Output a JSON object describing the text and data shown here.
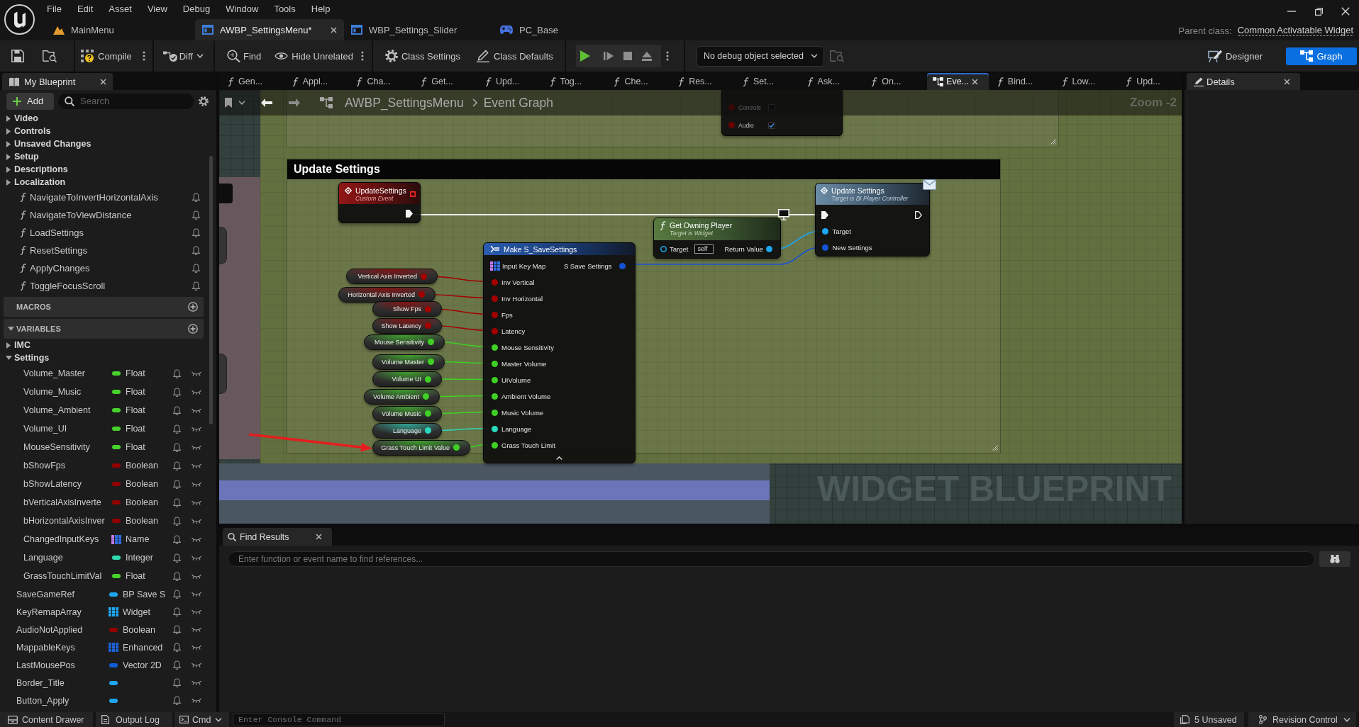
{
  "menu_bar": [
    "File",
    "Edit",
    "Asset",
    "View",
    "Debug",
    "Window",
    "Tools",
    "Help"
  ],
  "asset_tabs": [
    {
      "label": "MainMenu",
      "kind": "level",
      "selected": false
    },
    {
      "label": "AWBP_SettingsMenu*",
      "kind": "widget",
      "selected": true
    },
    {
      "label": "WBP_Settings_Slider",
      "kind": "widget",
      "selected": false
    },
    {
      "label": "PC_Base",
      "kind": "controller",
      "selected": false
    }
  ],
  "parent_class": {
    "label": "Parent class:",
    "value": "Common Activatable Widget"
  },
  "toolbar": {
    "buttons": [
      {
        "kind": "compile",
        "label": "Compile"
      },
      {
        "kind": "diff",
        "label": "Diff"
      },
      {
        "kind": "find",
        "label": "Find"
      },
      {
        "kind": "hide",
        "label": "Hide Unrelated"
      },
      {
        "kind": "settings",
        "label": "Class Settings"
      },
      {
        "kind": "defaults",
        "label": "Class Defaults"
      }
    ],
    "debug_object": "No debug object selected",
    "modes": [
      {
        "kind": "designer",
        "label": "Designer",
        "selected": false
      },
      {
        "kind": "graph",
        "label": "Graph",
        "selected": true
      }
    ]
  },
  "my_blueprint": {
    "tab": "My Blueprint",
    "add": "Add",
    "search": {
      "placeholder": "Search"
    },
    "categories": [
      {
        "label": "Video",
        "expanded": false
      },
      {
        "label": "Controls",
        "expanded": false
      },
      {
        "label": "Unsaved Changes",
        "expanded": false
      },
      {
        "label": "Setup",
        "expanded": false
      },
      {
        "label": "Descriptions",
        "expanded": false
      },
      {
        "label": "Localization",
        "expanded": false
      }
    ],
    "functions": [
      "NavigateToInvertHorizontalAxis",
      "NavigateToViewDistance",
      "LoadSettings",
      "ResetSettings",
      "ApplyChanges",
      "ToggleFocusScroll"
    ],
    "macros": {
      "label": "MACROS"
    },
    "variables": {
      "label": "VARIABLES",
      "expanded": true,
      "items": [
        {
          "kind": "category",
          "label": "IMC",
          "expanded": false
        },
        {
          "kind": "category",
          "label": "Settings",
          "expanded": true,
          "children": [
            {
              "name": "Volume_Master",
              "type": "Float",
              "kind": "single",
              "color": "#48d22c"
            },
            {
              "name": "Volume_Music",
              "type": "Float",
              "kind": "single",
              "color": "#48d22c"
            },
            {
              "name": "Volume_Ambient",
              "type": "Float",
              "kind": "single",
              "color": "#48d22c"
            },
            {
              "name": "Volume_UI",
              "type": "Float",
              "kind": "single",
              "color": "#48d22c"
            },
            {
              "name": "MouseSensitivity",
              "type": "Float",
              "kind": "single",
              "color": "#48d22c"
            },
            {
              "name": "bShowFps",
              "type": "Boolean",
              "kind": "single",
              "color": "#940000"
            },
            {
              "name": "bShowLatency",
              "type": "Boolean",
              "kind": "single",
              "color": "#940000"
            },
            {
              "name": "bVerticalAxisInverte",
              "type": "Boolean",
              "kind": "single",
              "color": "#940000"
            },
            {
              "name": "bHorizontalAxisInver",
              "type": "Boolean",
              "kind": "single",
              "color": "#940000"
            },
            {
              "name": "ChangedInputKeys",
              "type": "Name",
              "kind": "map",
              "color": "#c67cf0"
            },
            {
              "name": "Language",
              "type": "Integer",
              "kind": "single",
              "color": "#2ddcb2"
            },
            {
              "name": "GrassTouchLimitVal",
              "type": "Float",
              "kind": "single",
              "color": "#48d22c"
            }
          ]
        },
        {
          "kind": "single",
          "name": "SaveGameRef",
          "type": "BP Save S",
          "color": "#1ea6ee"
        },
        {
          "kind": "array",
          "name": "KeyRemapArray",
          "type": "Widget",
          "color": "#1ea6ee"
        },
        {
          "kind": "single",
          "name": "AudioNotApplied",
          "type": "Boolean",
          "color": "#940000"
        },
        {
          "kind": "array",
          "name": "MappableKeys",
          "type": "Enhanced",
          "color": "#1c62d8"
        },
        {
          "kind": "single",
          "name": "LastMousePos",
          "type": "Vector 2D",
          "color": "#0f5ed8"
        },
        {
          "kind": "single",
          "name": "Border_Title",
          "color": "#1ea6ee"
        },
        {
          "kind": "single",
          "name": "Button_Apply",
          "color": "#1ea6ee"
        }
      ]
    }
  },
  "graph_editor": {
    "tabs": [
      {
        "label": "Gen...",
        "kind": "function",
        "selected": false
      },
      {
        "label": "Appl...",
        "kind": "function",
        "selected": false
      },
      {
        "label": "Cha...",
        "kind": "function",
        "selected": false
      },
      {
        "label": "Get...",
        "kind": "function",
        "selected": false
      },
      {
        "label": "Upd...",
        "kind": "function",
        "selected": false
      },
      {
        "label": "Tog...",
        "kind": "function",
        "selected": false
      },
      {
        "label": "Che...",
        "kind": "function",
        "selected": false
      },
      {
        "label": "Res...",
        "kind": "function",
        "selected": false
      },
      {
        "label": "Set...",
        "kind": "function",
        "selected": false
      },
      {
        "label": "Ask...",
        "kind": "function",
        "selected": false
      },
      {
        "label": "On...",
        "kind": "function",
        "selected": false
      },
      {
        "label": "Eve...",
        "kind": "graph",
        "selected": true
      },
      {
        "label": "Bind...",
        "kind": "function",
        "selected": false
      },
      {
        "label": "Low...",
        "kind": "function",
        "selected": false
      },
      {
        "label": "Upd...",
        "kind": "function",
        "selected": false
      }
    ],
    "breadcrumb": [
      "AWBP_SettingsMenu",
      "Event Graph"
    ],
    "zoom": "Zoom -2",
    "watermark": "WIDGET BLUEPRINT",
    "checkbox_node": {
      "rows": [
        {
          "label": "Controls",
          "checked": false
        },
        {
          "label": "Audio",
          "checked": true
        }
      ]
    },
    "comment": {
      "title": "Update Settings"
    },
    "event_node": {
      "title": "UpdateSettings",
      "subtitle": "Custom Event"
    },
    "get_owning_player": {
      "title": "Get Owning Player",
      "subtitle": "Target is Widget",
      "input": "Target",
      "input_value": "self",
      "output": "Return Value"
    },
    "call_node": {
      "title": "Update Settings",
      "subtitle": "Target is BI Player Controller",
      "inputs": [
        {
          "label": "Target",
          "color": "#1ea6f3"
        },
        {
          "label": "New Settings",
          "color": "#1553d6"
        }
      ]
    },
    "make_node": {
      "title": "Make S_SaveSettings",
      "output": "S Save Settings",
      "pins": [
        {
          "label": "Input Key Map",
          "kind": "map",
          "color": "#c67cf0"
        },
        {
          "label": "Inv Vertical",
          "kind": "value",
          "color": "#a30000"
        },
        {
          "label": "Inv Horizontal",
          "kind": "value",
          "color": "#a30000"
        },
        {
          "label": "Fps",
          "kind": "value",
          "color": "#a30000"
        },
        {
          "label": "Latency",
          "kind": "value",
          "color": "#a30000"
        },
        {
          "label": "Mouse Sensitivity",
          "kind": "value",
          "color": "#3fd025"
        },
        {
          "label": "Master Volume",
          "kind": "value",
          "color": "#3fd025"
        },
        {
          "label": "UIVolume",
          "kind": "value",
          "color": "#3fd025"
        },
        {
          "label": "Ambient Volume",
          "kind": "value",
          "color": "#3fd025"
        },
        {
          "label": "Music Volume",
          "kind": "value",
          "color": "#3fd025"
        },
        {
          "label": "Language",
          "kind": "value",
          "color": "#2ad8bd"
        },
        {
          "label": "Grass Touch Limit",
          "kind": "value",
          "color": "#3fd025"
        }
      ]
    },
    "variable_nodes": [
      {
        "label": "Vertical Axis Inverted",
        "color": "#a30000"
      },
      {
        "label": "Horizontal Axis Inverted",
        "color": "#a30000"
      },
      {
        "label": "Show Fps",
        "color": "#a30000"
      },
      {
        "label": "Show Latency",
        "color": "#a30000"
      },
      {
        "label": "Mouse Sensitivity",
        "color": "#3fd025"
      },
      {
        "label": "Volume Master",
        "color": "#3fd025"
      },
      {
        "label": "Volume UI",
        "color": "#3fd025"
      },
      {
        "label": "Volume Ambient",
        "color": "#3fd025"
      },
      {
        "label": "Volume Music",
        "color": "#3fd025"
      },
      {
        "label": "Language",
        "color": "#2ad8bd"
      },
      {
        "label": "Grass Touch Limit Value",
        "color": "#3fd025"
      }
    ]
  },
  "details": {
    "tab": "Details"
  },
  "find_results": {
    "tab": "Find Results",
    "search": {
      "placeholder": "Enter function or event name to find references..."
    }
  },
  "status_bar": {
    "left": [
      {
        "kind": "drawer",
        "label": "Content Drawer"
      },
      {
        "kind": "log",
        "label": "Output Log"
      },
      {
        "kind": "cmd",
        "label": "Cmd"
      }
    ],
    "console": {
      "placeholder": "Enter Console Command"
    },
    "right": [
      {
        "kind": "unsaved",
        "label": "5 Unsaved"
      },
      {
        "kind": "revision",
        "label": "Revision Control"
      }
    ]
  }
}
